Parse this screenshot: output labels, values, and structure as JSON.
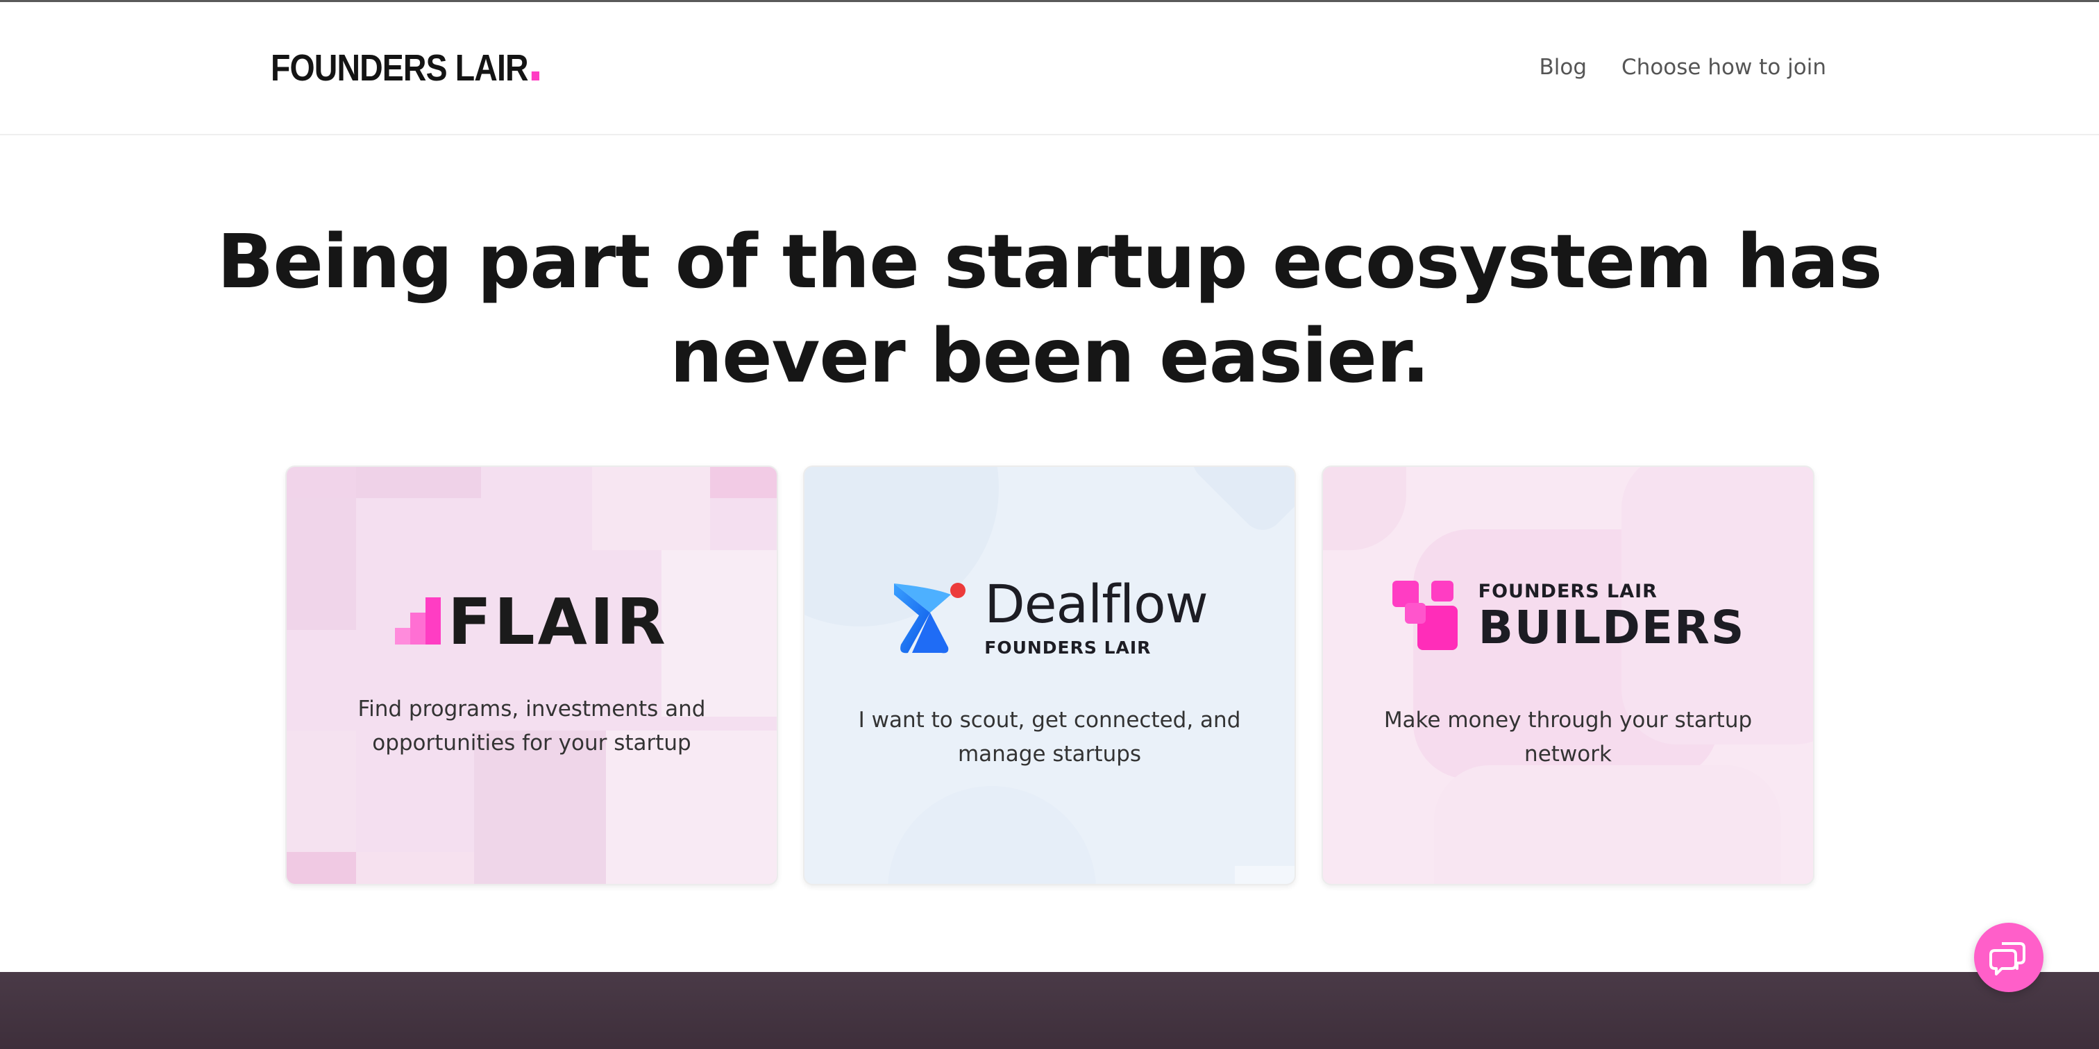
{
  "header": {
    "logo_text": "FOUNDERS LAIR",
    "nav": [
      {
        "label": "Blog"
      },
      {
        "label": "Choose how to join"
      }
    ]
  },
  "hero": {
    "headline_line1": "Being part of the startup ecosystem has",
    "headline_line2": "never been easier."
  },
  "cards": [
    {
      "logo_text": "FLAIR",
      "description_line1": "Find programs, investments and",
      "description_line2": "opportunities for your startup"
    },
    {
      "logo_title": "Dealflow",
      "logo_subtitle": "FOUNDERS LAIR",
      "description_line1": "I want to scout, get connected, and",
      "description_line2": "manage startups"
    },
    {
      "logo_small": "FOUNDERS LAIR",
      "logo_big": "BUILDERS",
      "description_line1": "Make money through your startup",
      "description_line2": "network"
    }
  ],
  "chat": {
    "icon": "chat-bubbles-icon"
  },
  "colors": {
    "brand_pink": "#ff3dc3",
    "chat_button": "#ff5fc9",
    "dealflow_blue": "#1f6cf5",
    "footer_band": "#45363f"
  }
}
